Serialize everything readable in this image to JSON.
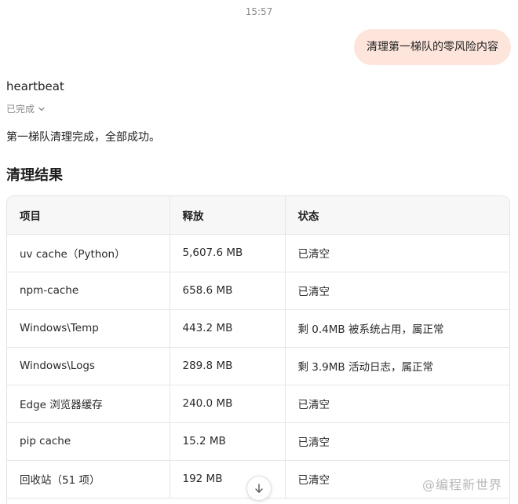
{
  "timestamp": "15:57",
  "user_message": "清理第一梯队的零风险内容",
  "assistant": {
    "name": "heartbeat",
    "status_label": "已完成",
    "summary": "第一梯队清理完成，全部成功。"
  },
  "section_title": "清理结果",
  "table": {
    "headers": [
      "项目",
      "释放",
      "状态"
    ],
    "rows": [
      [
        "uv cache（Python）",
        "5,607.6 MB",
        "已清空"
      ],
      [
        "npm-cache",
        "658.6 MB",
        "已清空"
      ],
      [
        "Windows\\Temp",
        "443.2 MB",
        "剩 0.4MB 被系统占用，属正常"
      ],
      [
        "Windows\\Logs",
        "289.8 MB",
        "剩 3.9MB 活动日志，属正常"
      ],
      [
        "Edge 浏览器缓存",
        "240.0 MB",
        "已清空"
      ],
      [
        "pip cache",
        "15.2 MB",
        "已清空"
      ],
      [
        "回收站（51 项）",
        "192 MB",
        "已清空"
      ]
    ]
  },
  "watermark": "@编程新世界",
  "icons": {
    "status_toggle": "chevron-down-icon",
    "scroll_button": "arrow-down-icon"
  }
}
